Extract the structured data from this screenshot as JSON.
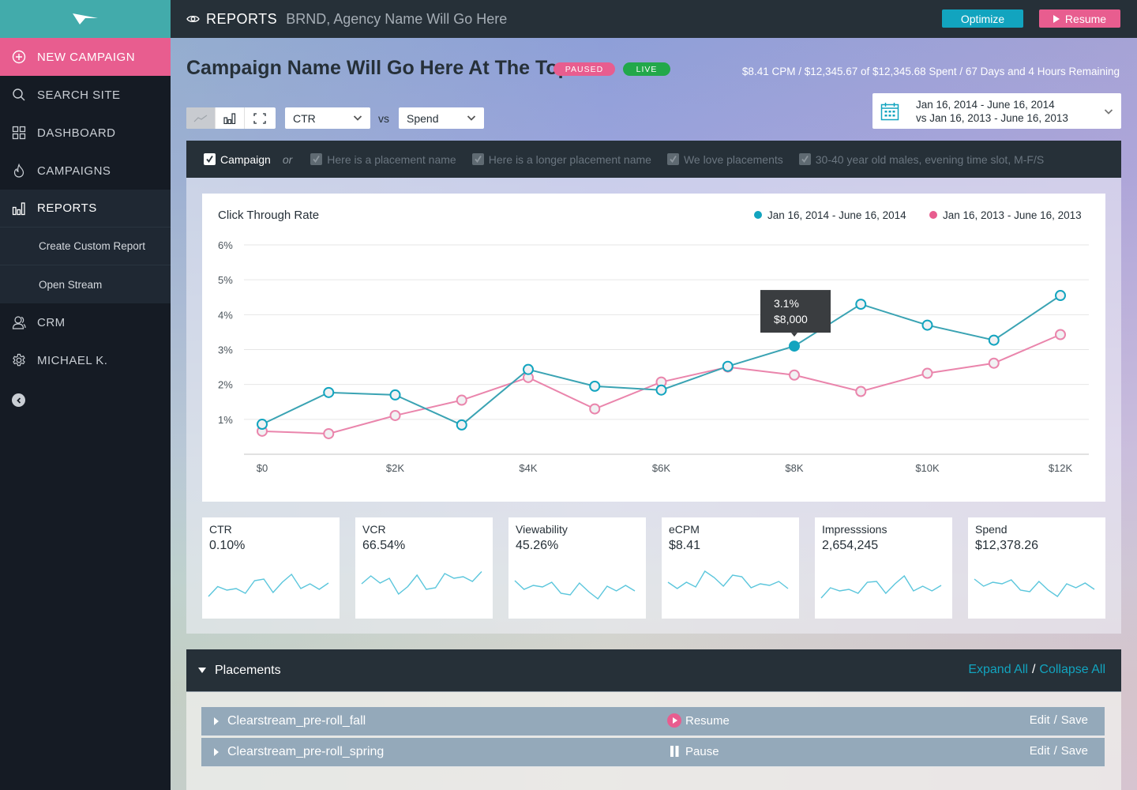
{
  "sidebar": {
    "logo": "paper-plane-logo",
    "new_campaign": "NEW CAMPAIGN",
    "items": [
      {
        "label": "SEARCH SITE",
        "icon": "search-icon"
      },
      {
        "label": "DASHBOARD",
        "icon": "grid-icon"
      },
      {
        "label": "CAMPAIGNS",
        "icon": "flame-icon"
      },
      {
        "label": "REPORTS",
        "icon": "bar-chart-icon",
        "active": true
      },
      {
        "label": "CRM",
        "icon": "users-icon"
      },
      {
        "label": "MICHAEL K.",
        "icon": "gear-icon"
      }
    ],
    "sub_items": [
      "Create Custom Report",
      "Open Stream"
    ]
  },
  "topbar": {
    "section": "REPORTS",
    "agency": "BRND, Agency Name Will Go Here",
    "optimize_label": "Optimize",
    "resume_label": "Resume"
  },
  "campaign": {
    "title": "Campaign Name Will Go Here At The Top",
    "badges": [
      "PAUSED",
      "LIVE"
    ],
    "summary": "$8.41 CPM / $12,345.67 of $12,345.68 Spent / 67 Days and 4 Hours Remaining"
  },
  "controls": {
    "metric": "CTR",
    "vs": "vs",
    "compare": "Spend",
    "date_range": "Jan 16, 2014 - June 16, 2014",
    "compare_range": "vs Jan 16, 2013 - June 16, 2013"
  },
  "filters": {
    "campaign": "Campaign",
    "or": "or",
    "placements": [
      "Here is a placement name",
      "Here is a longer placement name",
      "We love placements",
      "30-40 year old males, evening time slot, M-F/S"
    ]
  },
  "colors": {
    "accent": "#12a4bf",
    "pink": "#e85d8f",
    "live": "#22a84a",
    "dark": "#263038",
    "series_2014": "#3aa3b3",
    "series_2013": "#ea85ac"
  },
  "chart_data": {
    "type": "line",
    "title": "Click Through Rate",
    "xlabel": "",
    "ylabel": "",
    "x": [
      0,
      1000,
      2000,
      3000,
      4000,
      5000,
      6000,
      7000,
      8000,
      9000,
      10000,
      11000,
      12000
    ],
    "x_ticks": [
      0,
      2000,
      4000,
      6000,
      8000,
      10000,
      12000
    ],
    "x_tick_labels": [
      "$0",
      "$2K",
      "$4K",
      "$6K",
      "$8K",
      "$10K",
      "$12K"
    ],
    "y_ticks": [
      1,
      2,
      3,
      4,
      5,
      6
    ],
    "y_tick_labels": [
      "1%",
      "2%",
      "3%",
      "4%",
      "5%",
      "6%"
    ],
    "ylim": [
      0,
      6
    ],
    "xlim": [
      0,
      12000
    ],
    "grid": true,
    "legend_position": "top-right",
    "series": [
      {
        "name": "Jan 16, 2014 - June 16, 2014",
        "values": [
          0.86,
          1.77,
          1.7,
          0.84,
          2.43,
          1.95,
          1.84,
          2.52,
          3.1,
          4.3,
          3.7,
          3.27,
          4.55
        ]
      },
      {
        "name": "Jan 16, 2013 - June 16, 2013",
        "values": [
          0.66,
          0.59,
          1.11,
          1.55,
          2.2,
          1.3,
          2.07,
          2.5,
          2.27,
          1.8,
          2.32,
          2.61,
          3.43
        ]
      }
    ],
    "tooltip": {
      "series": 0,
      "index": 8,
      "line1": "3.1%",
      "line2": "$8,000"
    }
  },
  "kpis": [
    {
      "label": "CTR",
      "value": "0.10%",
      "spark": [
        3,
        5.5,
        4.6,
        5,
        3.8,
        7,
        7.4,
        4,
        6.6,
        8.6,
        5,
        6.2,
        4.8,
        6.4
      ]
    },
    {
      "label": "VCR",
      "value": "66.54%",
      "spark": [
        6.2,
        8.2,
        6.4,
        7.6,
        3.6,
        5.5,
        8.4,
        4.8,
        5.2,
        8.8,
        7.6,
        8,
        6.8,
        9.3
      ]
    },
    {
      "label": "Viewability",
      "value": "45.26%",
      "spark": [
        7,
        4.8,
        5.8,
        5.4,
        6.6,
        3.8,
        3.4,
        6.4,
        4.2,
        2.4,
        5.6,
        4.4,
        5.8,
        4.4
      ]
    },
    {
      "label": "eCPM",
      "value": "$8.41",
      "spark": [
        6.6,
        5,
        6.6,
        5.4,
        9.4,
        7.8,
        5.6,
        8.4,
        8,
        5.2,
        6.2,
        5.8,
        6.8,
        5
      ]
    },
    {
      "label": "Impresssions",
      "value": "2,654,245",
      "spark": [
        2.6,
        5.2,
        4.4,
        4.8,
        3.8,
        6.6,
        6.8,
        3.8,
        6.2,
        8.2,
        4.4,
        5.6,
        4.4,
        5.8
      ]
    },
    {
      "label": "Spend",
      "value": "$12,378.26",
      "spark": [
        7.4,
        5.6,
        6.6,
        6.2,
        7.2,
        4.6,
        4.2,
        6.8,
        4.6,
        3,
        6.2,
        5.2,
        6.4,
        4.8
      ]
    }
  ],
  "placements": {
    "title": "Placements",
    "expand_all": "Expand All",
    "sep": "/",
    "collapse_all": "Collapse All",
    "rows": [
      {
        "name": "Clearstream_pre-roll_fall",
        "status": "Resume",
        "status_icon": "play-circle-icon",
        "edit": "Edit",
        "save": "Save"
      },
      {
        "name": "Clearstream_pre-roll_spring",
        "status": "Pause",
        "status_icon": "pause-icon",
        "edit": "Edit",
        "save": "Save"
      }
    ]
  }
}
